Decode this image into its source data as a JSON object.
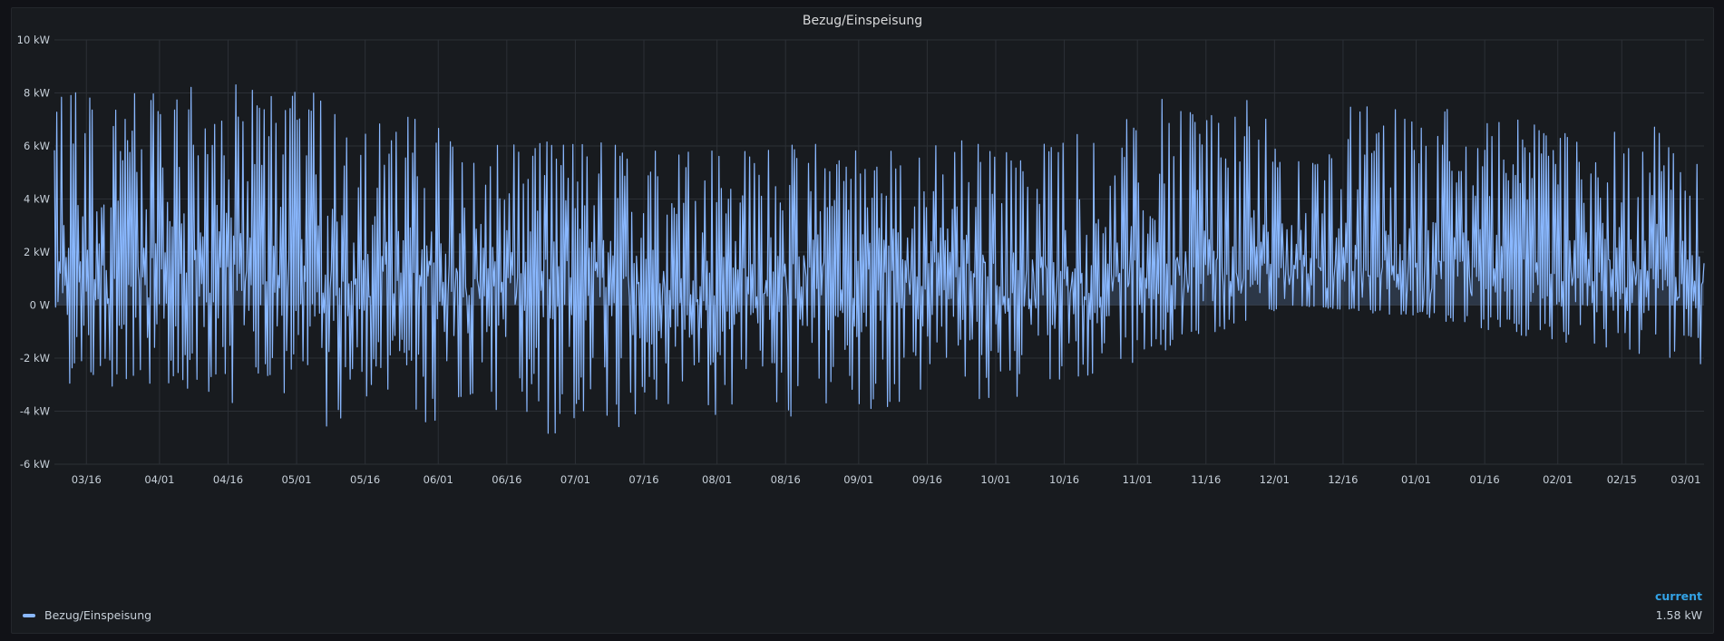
{
  "panel": {
    "title": "Bezug/Einspeisung"
  },
  "legend": {
    "series_name": "Bezug/Einspeisung",
    "stat_label": "current",
    "stat_value": "1.58 kW"
  },
  "colors": {
    "series_line": "#8ab8ff",
    "series_fill": "rgba(138,184,255,0.18)",
    "grid": "#2c3036",
    "stat_header": "#33a2e5"
  },
  "chart_data": {
    "type": "line",
    "title": "Bezug/Einspeisung",
    "xlabel": "",
    "ylabel": "",
    "unit": "kW",
    "ylim": [
      -6,
      10
    ],
    "yticks": [
      "10 kW",
      "8 kW",
      "6 kW",
      "4 kW",
      "2 kW",
      "0 W",
      "-2 kW",
      "-4 kW",
      "-6 kW"
    ],
    "x_range": [
      "03/09",
      "03/05"
    ],
    "xticks": [
      "03/16",
      "04/01",
      "04/16",
      "05/01",
      "05/16",
      "06/01",
      "06/16",
      "07/01",
      "07/16",
      "08/01",
      "08/16",
      "09/01",
      "09/16",
      "10/01",
      "10/16",
      "11/01",
      "11/16",
      "12/01",
      "12/16",
      "01/01",
      "01/16",
      "02/01",
      "02/15",
      "03/01"
    ],
    "grid": true,
    "fill_below": true,
    "legend_placement": "bottom-left",
    "series": [
      {
        "name": "Bezug/Einspeisung",
        "envelope_monthly": [
          {
            "month": "03",
            "max": 8.5,
            "min": -3.3
          },
          {
            "month": "04",
            "max": 8.5,
            "min": -3.6
          },
          {
            "month": "05",
            "max": 8.0,
            "min": -4.6
          },
          {
            "month": "06",
            "max": 6.6,
            "min": -5.3
          },
          {
            "month": "07",
            "max": 6.2,
            "min": -4.7
          },
          {
            "month": "08",
            "max": 6.0,
            "min": -4.3
          },
          {
            "month": "09",
            "max": 6.3,
            "min": -4.0
          },
          {
            "month": "10",
            "max": 6.3,
            "min": -3.6
          },
          {
            "month": "11",
            "max": 7.8,
            "min": -1.9
          },
          {
            "month": "12",
            "max": 7.7,
            "min": 0.0
          },
          {
            "month": "01",
            "max": 7.6,
            "min": -0.5
          },
          {
            "month": "02",
            "max": 6.9,
            "min": -1.5
          },
          {
            "month": "03",
            "max": 6.8,
            "min": -2.4
          }
        ],
        "current": 1.58
      }
    ]
  }
}
